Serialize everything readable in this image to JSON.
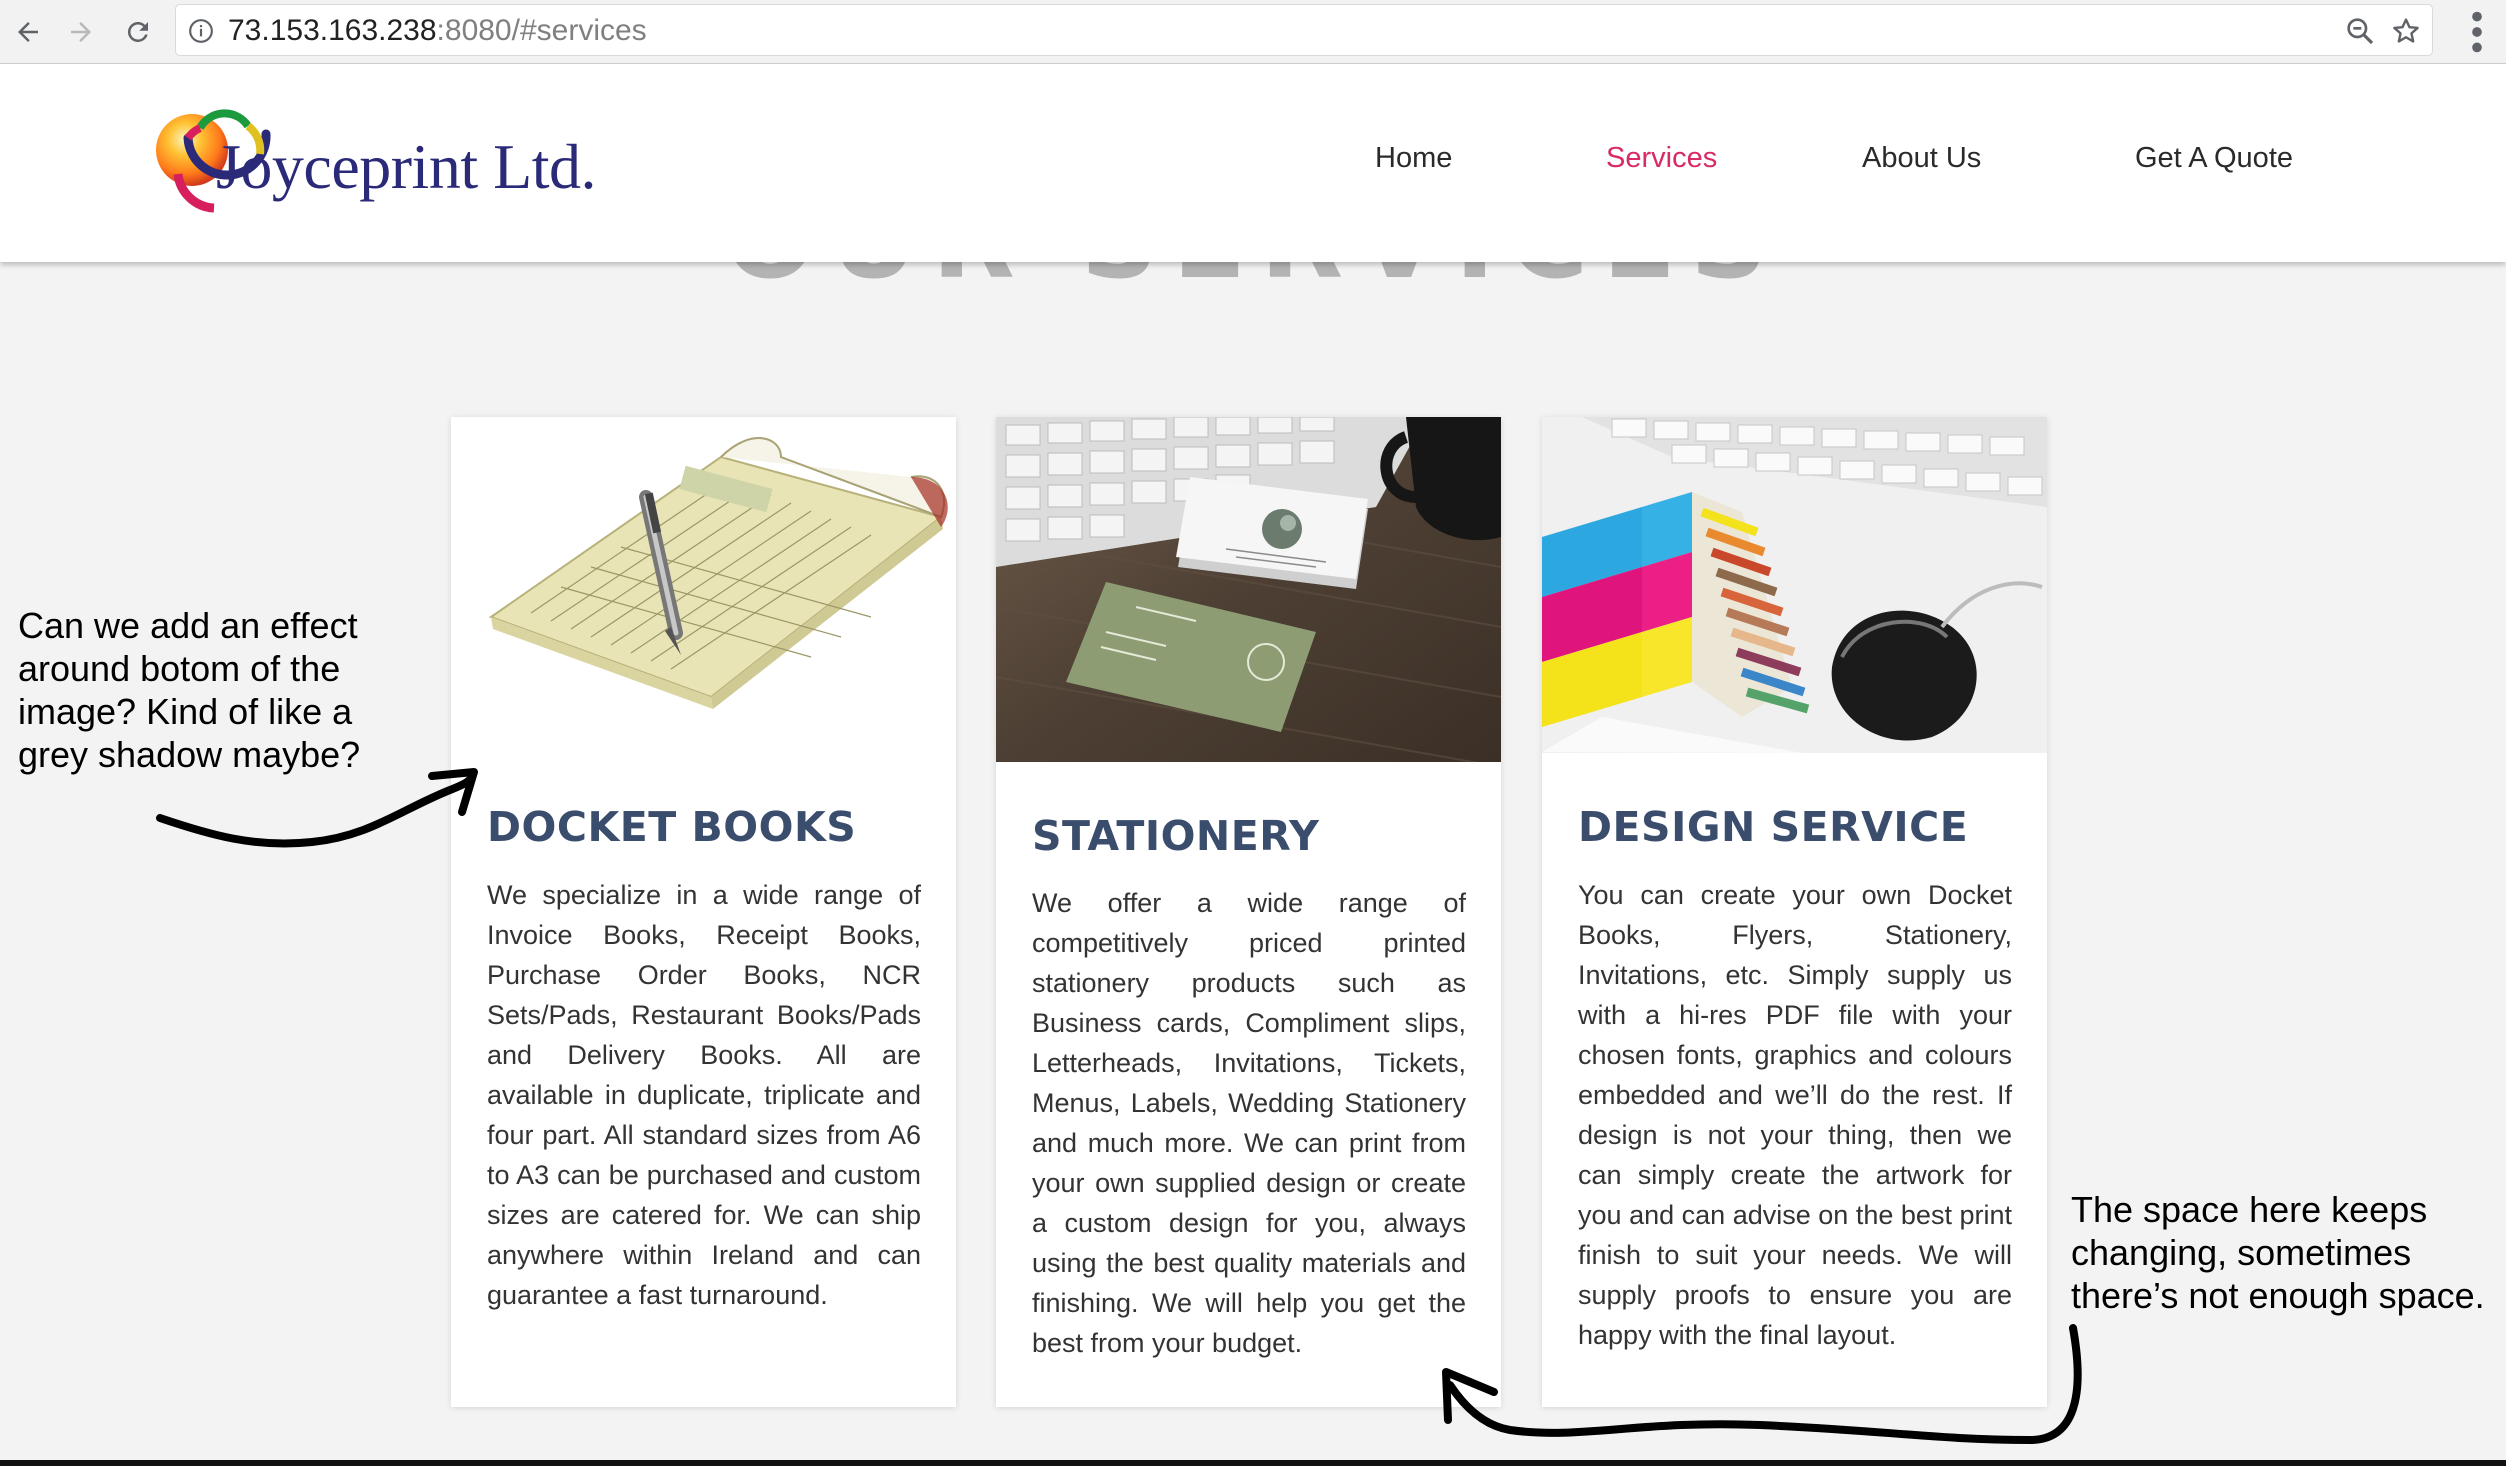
{
  "browser": {
    "url_host": "73.153.163.238",
    "url_rest": ":8080/#services",
    "icons": [
      "back-arrow-icon",
      "forward-arrow-icon",
      "reload-icon",
      "info-icon",
      "zoom-icon",
      "bookmark-star-icon",
      "more-menu-icon"
    ]
  },
  "header": {
    "logo_text": "Joyceprint Ltd.",
    "nav": [
      {
        "label": "Home",
        "active": false
      },
      {
        "label": "Services",
        "active": true
      },
      {
        "label": "About Us",
        "active": false
      },
      {
        "label": "Get A Quote",
        "active": false
      }
    ],
    "active_color": "#d82a67"
  },
  "section": {
    "title": "OUR SERVICES"
  },
  "cards": [
    {
      "title": "DOCKET BOOKS",
      "body": "We specialize in a wide range of Invoice Books, Receipt Books, Purchase Order Books, NCR Sets/Pads, Restaurant Books/Pads and Delivery Books. All are available in duplicate, triplicate and four part. All standard sizes from A6 to A3 can be purchased and custom sizes are catered for. We can ship anywhere within Ireland and can guarantee a fast turnaround.",
      "image": "docket-book-with-pen"
    },
    {
      "title": "STATIONERY",
      "body": "We offer a wide range of competitively priced printed stationery products such as Business cards, Compliment slips, Letterheads, Invitations, Tickets, Menus, Labels, Wedding Stationery and much more. We can print from your own supplied design or create a custom design for you, always using the best quality materials and finishing. We will help you get the best from your budget.",
      "image": "business-cards-on-desk"
    },
    {
      "title": "DESIGN SERVICE",
      "body": "You can create your own Docket Books, Flyers, Stationery, Invitations, etc. Simply supply us with a hi-res PDF file with your chosen fonts, graphics and colours embedded and we’ll do the rest. If design is not your thing, then we can simply create the artwork for you and can advise on the best print finish to suit your needs. We will supply proofs to ensure you are happy with the final layout.",
      "image": "colour-swatch-with-keyboard"
    }
  ],
  "annotations": {
    "left_note": "Can we add an effect around botom of the image? Kind of like a grey shadow maybe?",
    "right_note": "The space here keeps changing, sometimes there’s not enough space."
  },
  "colors": {
    "title_color": "#3b4d6c",
    "logo_color": "#2b2a78",
    "page_bg": "#f3f3f3"
  }
}
